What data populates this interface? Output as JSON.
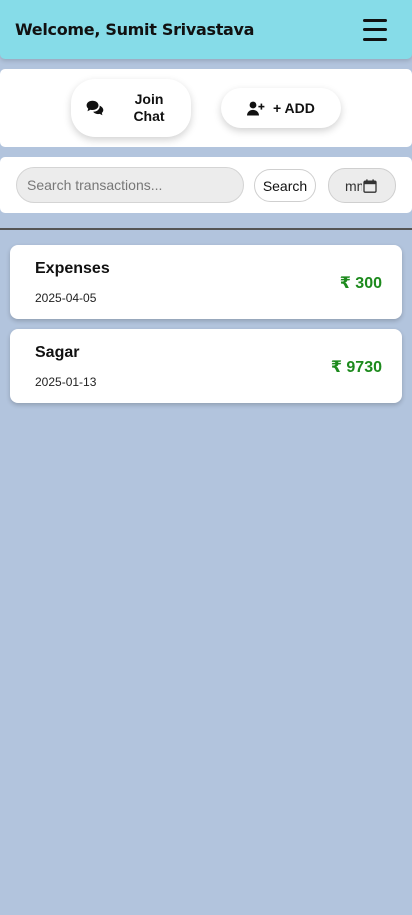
{
  "header": {
    "welcome": "Welcome, Sumit Srivastava",
    "menu_icon": "hamburger-icon"
  },
  "actions": {
    "join_chat_label": "Join Chat",
    "join_chat_icon": "comments-icon",
    "add_label": "+ ADD",
    "add_icon": "user-plus-icon"
  },
  "search": {
    "placeholder": "Search transactions...",
    "value": "",
    "button_label": "Search",
    "date_placeholder": "mm/dd/yyyy",
    "date_icon": "calendar-icon"
  },
  "transactions": [
    {
      "name": "Expenses",
      "date": "2025-04-05",
      "amount": "₹ 300"
    },
    {
      "name": "Sagar",
      "date": "2025-01-13",
      "amount": "₹ 9730"
    }
  ],
  "colors": {
    "header_bg": "#86dce8",
    "page_bg": "#b2c4dd",
    "amount_positive": "#1d8a1d"
  }
}
